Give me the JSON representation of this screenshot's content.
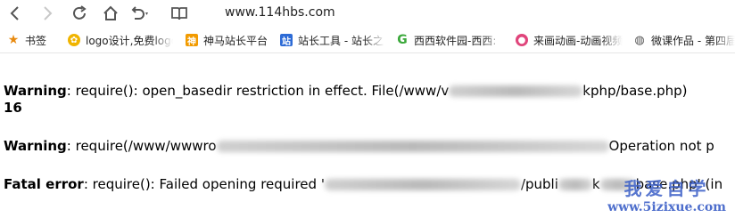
{
  "browser": {
    "url": "www.114hbs.com",
    "icons": [
      "back-icon",
      "forward-icon",
      "reload-icon",
      "home-icon",
      "undo-icon",
      "reader-icon"
    ]
  },
  "bookmarks": {
    "items": [
      {
        "label": "书签",
        "icon": "star-icon",
        "color": "#e88a10"
      },
      {
        "label": "logo设计,免费logo",
        "icon": "gear-icon",
        "color": "#f0b400"
      },
      {
        "label": "神马站长平台",
        "icon": "shenma-icon",
        "color": "#f29b00"
      },
      {
        "label": "站长工具 - 站长之",
        "icon": "zhanzhang-icon",
        "color": "#2d6bd6"
      },
      {
        "label": "西西软件园-西西:",
        "icon": "xixi-icon",
        "color": "#3aa83a"
      },
      {
        "label": "来画动画-动画视频",
        "icon": "laihua-icon",
        "color": "#e0457b"
      },
      {
        "label": "微课作品 - 第四届",
        "icon": "globe-icon",
        "color": "#555555"
      }
    ]
  },
  "errors": {
    "line1_label": "Warning",
    "line1_text": ": require(): open_basedir restriction in effect. File(/www/v",
    "line1_tail": "kphp/base.php)",
    "line1_num": "16",
    "line2_label": "Warning",
    "line2_text": ": require(/www/wwwro",
    "line2_tail": "Operation not p",
    "line3_label": "Fatal error",
    "line3_text": ": require(): Failed opening required '",
    "line3_mid": "/publi",
    "line3_mid2": "k",
    "line3_tail": "base.php' (in"
  },
  "watermark": {
    "title": "我爱自学",
    "url": "www.5izixue.com"
  }
}
